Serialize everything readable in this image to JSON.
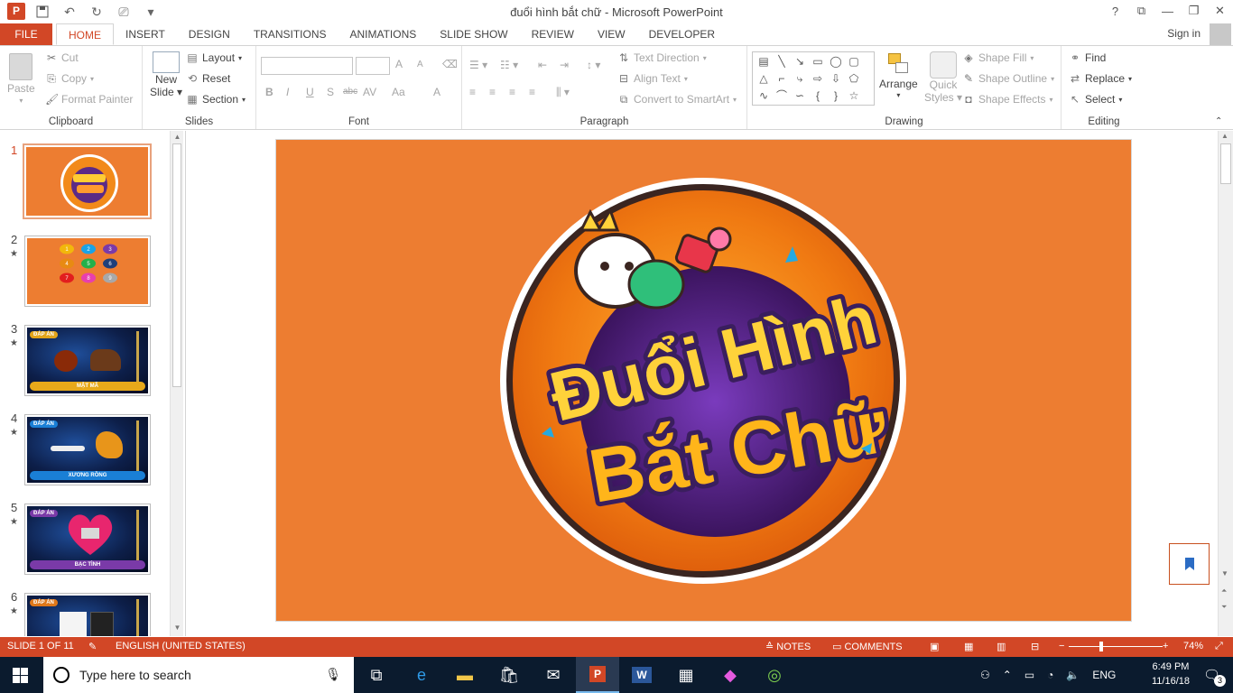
{
  "window": {
    "title": "đuổi hình bắt chữ - Microsoft PowerPoint",
    "app_icon": "P",
    "controls": [
      "?",
      "⧉",
      "—",
      "❐",
      "✕"
    ]
  },
  "ribbon_tabs": {
    "file": "FILE",
    "tabs": [
      "HOME",
      "INSERT",
      "DESIGN",
      "TRANSITIONS",
      "ANIMATIONS",
      "SLIDE SHOW",
      "REVIEW",
      "VIEW",
      "DEVELOPER"
    ],
    "active": "HOME",
    "sign_in": "Sign in"
  },
  "ribbon": {
    "clipboard": {
      "label": "Clipboard",
      "paste": "Paste",
      "cut": "Cut",
      "copy": "Copy",
      "format_painter": "Format Painter"
    },
    "slides": {
      "label": "Slides",
      "new_slide": "New",
      "new_slide2": "Slide",
      "layout": "Layout",
      "reset": "Reset",
      "section": "Section"
    },
    "font": {
      "label": "Font",
      "bold": "B",
      "italic": "I",
      "underline": "U",
      "shadow": "S",
      "strike": "abc",
      "spacing": "AV",
      "case": "Aa",
      "grow": "A",
      "shrink": "A",
      "color": "A"
    },
    "paragraph": {
      "label": "Paragraph",
      "text_direction": "Text Direction",
      "align_text": "Align Text",
      "smartart": "Convert to SmartArt"
    },
    "drawing": {
      "label": "Drawing",
      "arrange": "Arrange",
      "quick_styles": "Quick",
      "quick_styles2": "Styles",
      "shape_fill": "Shape Fill",
      "shape_outline": "Shape Outline",
      "shape_effects": "Shape Effects"
    },
    "editing": {
      "label": "Editing",
      "find": "Find",
      "replace": "Replace",
      "select": "Select"
    }
  },
  "thumbnails": [
    {
      "num": "1",
      "star": ""
    },
    {
      "num": "2",
      "star": "★",
      "buttons": [
        "1",
        "2",
        "3",
        "4",
        "5",
        "6",
        "7",
        "8",
        "9"
      ]
    },
    {
      "num": "3",
      "star": "★",
      "tag": "ĐÁP ÁN",
      "answer": "MẬT MÃ"
    },
    {
      "num": "4",
      "star": "★",
      "tag": "ĐÁP ÁN",
      "answer": "XƯƠNG RỒNG"
    },
    {
      "num": "5",
      "star": "★",
      "tag": "ĐÁP ÁN",
      "answer": "BẠC TÌNH"
    },
    {
      "num": "6",
      "star": "★",
      "tag": "ĐÁP ÁN",
      "answer": ""
    }
  ],
  "colors": {
    "accent": "#d24726",
    "slide_bg": "#ed7d31",
    "taskbar": "#0b1b2e"
  },
  "slide_logo": {
    "line1": "Đuổi Hình",
    "line2": "Bắt Chữ"
  },
  "status": {
    "slide_info": "SLIDE 1 OF 11",
    "language": "ENGLISH (UNITED STATES)",
    "notes": "NOTES",
    "comments": "COMMENTS",
    "zoom": "74%"
  },
  "taskbar": {
    "search_placeholder": "Type here to search",
    "lang": "ENG",
    "time": "6:49 PM",
    "date": "11/16/18",
    "notif_count": "3"
  }
}
